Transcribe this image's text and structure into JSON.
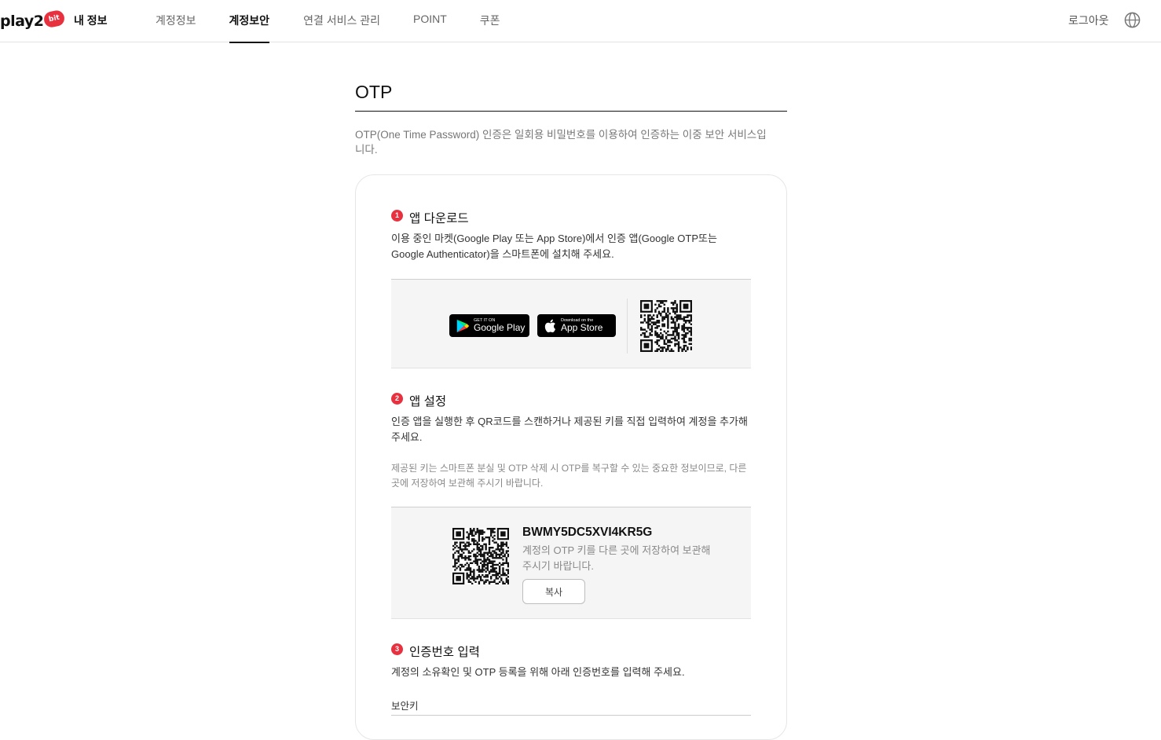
{
  "header": {
    "logo_text": "play2",
    "logo_badge": "bit",
    "my_info": "내 정보",
    "nav": [
      {
        "label": "계정정보",
        "active": false
      },
      {
        "label": "계정보안",
        "active": true
      },
      {
        "label": "연결 서비스 관리",
        "active": false
      },
      {
        "label": "POINT",
        "active": false
      },
      {
        "label": "쿠폰",
        "active": false
      }
    ],
    "logout": "로그아웃",
    "language_icon": "globe-icon"
  },
  "page": {
    "title": "OTP",
    "intro": "OTP(One Time Password) 인증은 일회용 비밀번호를 이용하여 인증하는 이중 보안 서비스입니다."
  },
  "steps": [
    {
      "number": "1",
      "title": "앱 다운로드",
      "desc": "이용 중인 마켓(Google Play 또는 App Store)에서 인증 앱(Google OTP또는 Google Authenticator)을 스마트폰에 설치해 주세요."
    },
    {
      "number": "2",
      "title": "앱 설정",
      "desc": "인증 앱을 실행한 후 QR코드를 스캔하거나 제공된 키를 직접 입력하여 계정을 추가해 주세요.",
      "note": "제공된 키는 스마트폰 분실 및 OTP 삭제 시 OTP를 복구할 수 있는 중요한 정보이므로, 다른 곳에 저장하여 보관해 주시기 바랍니다."
    },
    {
      "number": "3",
      "title": "인증번호 입력",
      "desc": "계정의 소유확인 및 OTP 등록을 위해 아래 인증번호를 입력해 주세요."
    }
  ],
  "stores": {
    "google_small": "GET IT ON",
    "google_big": "Google Play",
    "apple_small": "Download on the",
    "apple_big": "App Store"
  },
  "otp": {
    "key": "BWMY5DC5XVI4KR5G",
    "note": "계정의 OTP 키를 다른 곳에 저장하여 보관해 주시기 바랍니다.",
    "copy_label": "복사"
  },
  "input": {
    "label": "보안키"
  }
}
